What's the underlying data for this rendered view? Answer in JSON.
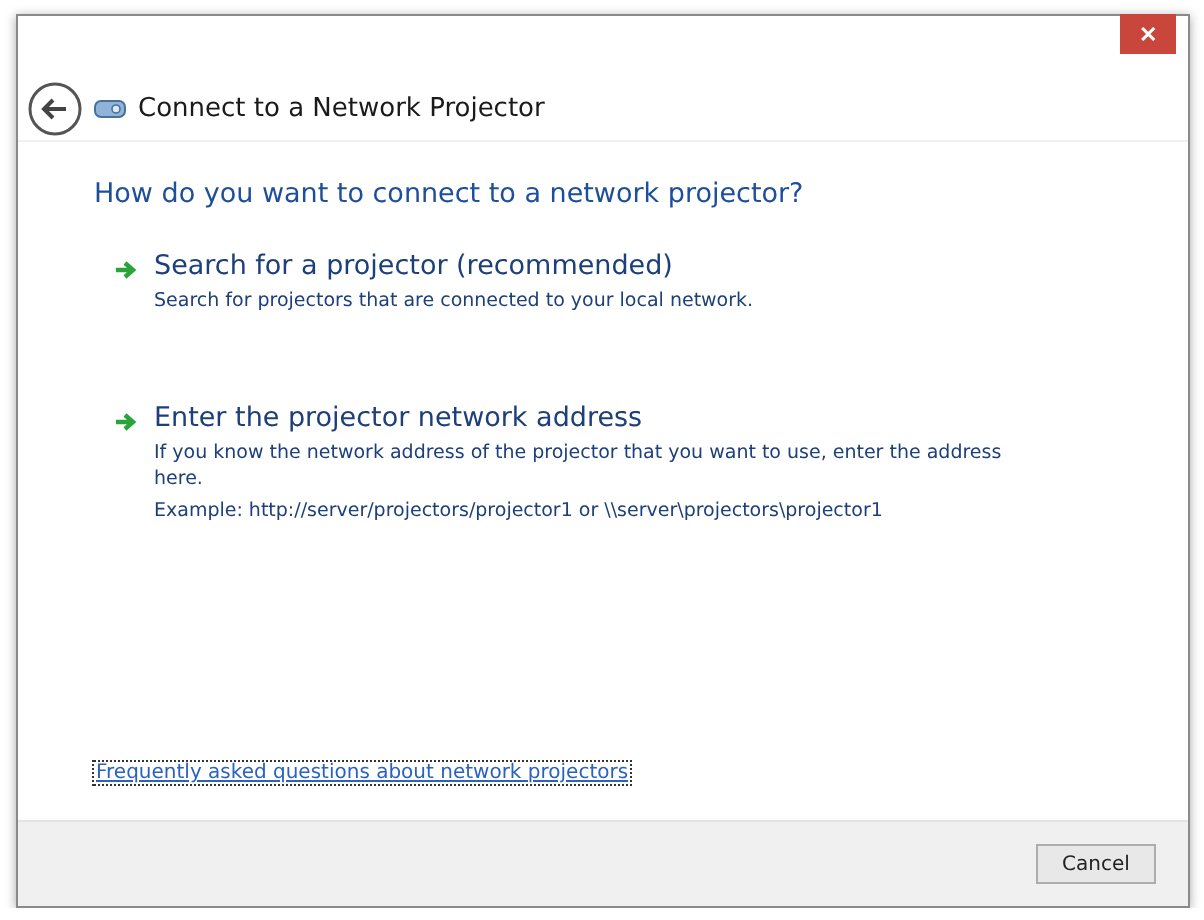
{
  "window": {
    "title": "Connect to a Network Projector",
    "close": "✕"
  },
  "heading": "How do you want to connect to a network projector?",
  "options": [
    {
      "title": "Search for a projector (recommended)",
      "description": [
        "Search for projectors that are connected to your local network."
      ]
    },
    {
      "title": "Enter the projector network address",
      "description": [
        "If you know the network address of the projector that you want to use, enter the address here.",
        "Example: http://server/projectors/projector1 or \\\\server\\projectors\\projector1"
      ]
    }
  ],
  "faq_link": {
    "label": "Frequently asked questions about network projectors",
    "focused": true
  },
  "buttons": [
    "Cancel"
  ]
}
